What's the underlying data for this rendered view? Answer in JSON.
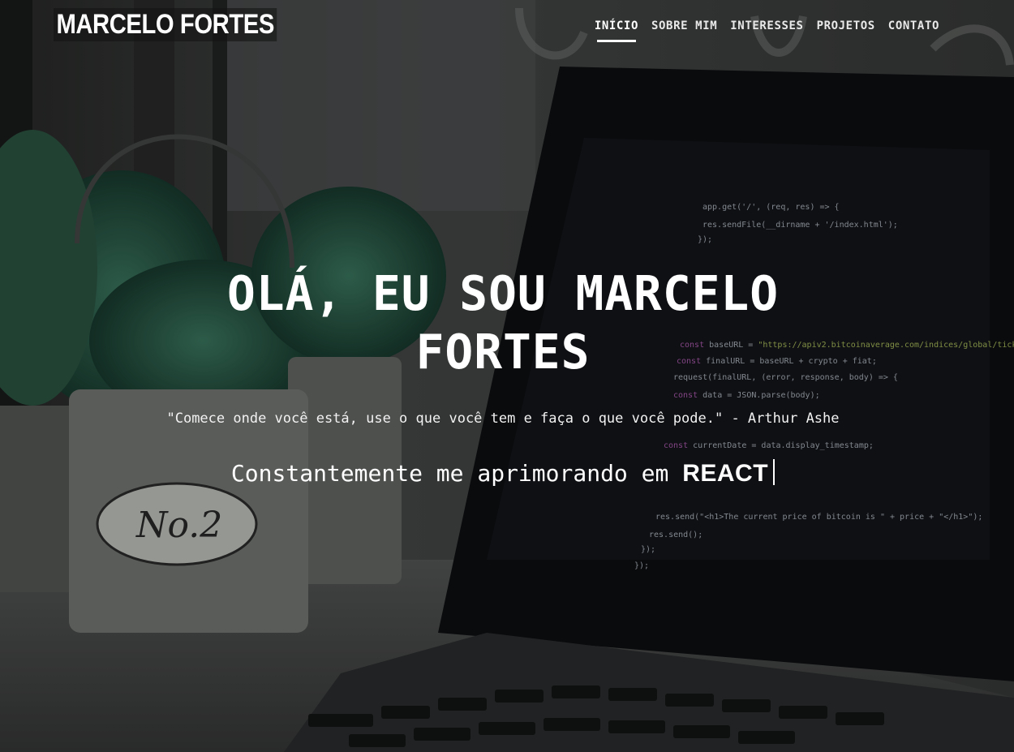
{
  "header": {
    "logo": "MARCELO FORTES",
    "nav": [
      {
        "label": "INÍCIO",
        "active": true
      },
      {
        "label": "SOBRE MIM",
        "active": false
      },
      {
        "label": "INTERESSES",
        "active": false
      },
      {
        "label": "PROJETOS",
        "active": false
      },
      {
        "label": "CONTATO",
        "active": false
      }
    ]
  },
  "hero": {
    "headline": "OLÁ, EU SOU MARCELO FORTES",
    "quote": "\"Comece onde você está, use o que você tem e faça o que você pode.\" - Arthur Ashe",
    "typing_prefix": "Constantemente me aprimorando em",
    "typing_word": "REACT"
  },
  "colors": {
    "text": "#ffffff",
    "overlay": "#000000",
    "code_string": "#c8e06a",
    "code_keyword": "#d16cd3"
  }
}
